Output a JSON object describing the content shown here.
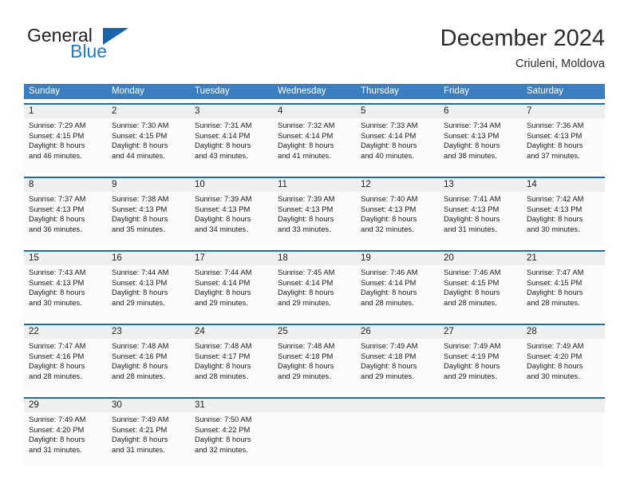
{
  "brand": {
    "name_part1": "General",
    "name_part2": "Blue",
    "logo_icon": "blue-triangle-icon"
  },
  "header": {
    "title": "December 2024",
    "location": "Criuleni, Moldova"
  },
  "colors": {
    "header_blue": "#3c7fc1",
    "week_divider_blue": "#1f6cb0",
    "day_number_band": "#efefef",
    "brand_blue": "#1e7bc4",
    "text": "#1a1a1a"
  },
  "weekdays": [
    "Sunday",
    "Monday",
    "Tuesday",
    "Wednesday",
    "Thursday",
    "Friday",
    "Saturday"
  ],
  "weeks": [
    {
      "days": [
        {
          "num": "1",
          "sunrise": "Sunrise: 7:29 AM",
          "sunset": "Sunset: 4:15 PM",
          "daylight_l1": "Daylight: 8 hours",
          "daylight_l2": "and 46 minutes."
        },
        {
          "num": "2",
          "sunrise": "Sunrise: 7:30 AM",
          "sunset": "Sunset: 4:15 PM",
          "daylight_l1": "Daylight: 8 hours",
          "daylight_l2": "and 44 minutes."
        },
        {
          "num": "3",
          "sunrise": "Sunrise: 7:31 AM",
          "sunset": "Sunset: 4:14 PM",
          "daylight_l1": "Daylight: 8 hours",
          "daylight_l2": "and 43 minutes."
        },
        {
          "num": "4",
          "sunrise": "Sunrise: 7:32 AM",
          "sunset": "Sunset: 4:14 PM",
          "daylight_l1": "Daylight: 8 hours",
          "daylight_l2": "and 41 minutes."
        },
        {
          "num": "5",
          "sunrise": "Sunrise: 7:33 AM",
          "sunset": "Sunset: 4:14 PM",
          "daylight_l1": "Daylight: 8 hours",
          "daylight_l2": "and 40 minutes."
        },
        {
          "num": "6",
          "sunrise": "Sunrise: 7:34 AM",
          "sunset": "Sunset: 4:13 PM",
          "daylight_l1": "Daylight: 8 hours",
          "daylight_l2": "and 38 minutes."
        },
        {
          "num": "7",
          "sunrise": "Sunrise: 7:36 AM",
          "sunset": "Sunset: 4:13 PM",
          "daylight_l1": "Daylight: 8 hours",
          "daylight_l2": "and 37 minutes."
        }
      ]
    },
    {
      "days": [
        {
          "num": "8",
          "sunrise": "Sunrise: 7:37 AM",
          "sunset": "Sunset: 4:13 PM",
          "daylight_l1": "Daylight: 8 hours",
          "daylight_l2": "and 36 minutes."
        },
        {
          "num": "9",
          "sunrise": "Sunrise: 7:38 AM",
          "sunset": "Sunset: 4:13 PM",
          "daylight_l1": "Daylight: 8 hours",
          "daylight_l2": "and 35 minutes."
        },
        {
          "num": "10",
          "sunrise": "Sunrise: 7:39 AM",
          "sunset": "Sunset: 4:13 PM",
          "daylight_l1": "Daylight: 8 hours",
          "daylight_l2": "and 34 minutes."
        },
        {
          "num": "11",
          "sunrise": "Sunrise: 7:39 AM",
          "sunset": "Sunset: 4:13 PM",
          "daylight_l1": "Daylight: 8 hours",
          "daylight_l2": "and 33 minutes."
        },
        {
          "num": "12",
          "sunrise": "Sunrise: 7:40 AM",
          "sunset": "Sunset: 4:13 PM",
          "daylight_l1": "Daylight: 8 hours",
          "daylight_l2": "and 32 minutes."
        },
        {
          "num": "13",
          "sunrise": "Sunrise: 7:41 AM",
          "sunset": "Sunset: 4:13 PM",
          "daylight_l1": "Daylight: 8 hours",
          "daylight_l2": "and 31 minutes."
        },
        {
          "num": "14",
          "sunrise": "Sunrise: 7:42 AM",
          "sunset": "Sunset: 4:13 PM",
          "daylight_l1": "Daylight: 8 hours",
          "daylight_l2": "and 30 minutes."
        }
      ]
    },
    {
      "days": [
        {
          "num": "15",
          "sunrise": "Sunrise: 7:43 AM",
          "sunset": "Sunset: 4:13 PM",
          "daylight_l1": "Daylight: 8 hours",
          "daylight_l2": "and 30 minutes."
        },
        {
          "num": "16",
          "sunrise": "Sunrise: 7:44 AM",
          "sunset": "Sunset: 4:13 PM",
          "daylight_l1": "Daylight: 8 hours",
          "daylight_l2": "and 29 minutes."
        },
        {
          "num": "17",
          "sunrise": "Sunrise: 7:44 AM",
          "sunset": "Sunset: 4:14 PM",
          "daylight_l1": "Daylight: 8 hours",
          "daylight_l2": "and 29 minutes."
        },
        {
          "num": "18",
          "sunrise": "Sunrise: 7:45 AM",
          "sunset": "Sunset: 4:14 PM",
          "daylight_l1": "Daylight: 8 hours",
          "daylight_l2": "and 29 minutes."
        },
        {
          "num": "19",
          "sunrise": "Sunrise: 7:46 AM",
          "sunset": "Sunset: 4:14 PM",
          "daylight_l1": "Daylight: 8 hours",
          "daylight_l2": "and 28 minutes."
        },
        {
          "num": "20",
          "sunrise": "Sunrise: 7:46 AM",
          "sunset": "Sunset: 4:15 PM",
          "daylight_l1": "Daylight: 8 hours",
          "daylight_l2": "and 28 minutes."
        },
        {
          "num": "21",
          "sunrise": "Sunrise: 7:47 AM",
          "sunset": "Sunset: 4:15 PM",
          "daylight_l1": "Daylight: 8 hours",
          "daylight_l2": "and 28 minutes."
        }
      ]
    },
    {
      "days": [
        {
          "num": "22",
          "sunrise": "Sunrise: 7:47 AM",
          "sunset": "Sunset: 4:16 PM",
          "daylight_l1": "Daylight: 8 hours",
          "daylight_l2": "and 28 minutes."
        },
        {
          "num": "23",
          "sunrise": "Sunrise: 7:48 AM",
          "sunset": "Sunset: 4:16 PM",
          "daylight_l1": "Daylight: 8 hours",
          "daylight_l2": "and 28 minutes."
        },
        {
          "num": "24",
          "sunrise": "Sunrise: 7:48 AM",
          "sunset": "Sunset: 4:17 PM",
          "daylight_l1": "Daylight: 8 hours",
          "daylight_l2": "and 28 minutes."
        },
        {
          "num": "25",
          "sunrise": "Sunrise: 7:48 AM",
          "sunset": "Sunset: 4:18 PM",
          "daylight_l1": "Daylight: 8 hours",
          "daylight_l2": "and 29 minutes."
        },
        {
          "num": "26",
          "sunrise": "Sunrise: 7:49 AM",
          "sunset": "Sunset: 4:18 PM",
          "daylight_l1": "Daylight: 8 hours",
          "daylight_l2": "and 29 minutes."
        },
        {
          "num": "27",
          "sunrise": "Sunrise: 7:49 AM",
          "sunset": "Sunset: 4:19 PM",
          "daylight_l1": "Daylight: 8 hours",
          "daylight_l2": "and 29 minutes."
        },
        {
          "num": "28",
          "sunrise": "Sunrise: 7:49 AM",
          "sunset": "Sunset: 4:20 PM",
          "daylight_l1": "Daylight: 8 hours",
          "daylight_l2": "and 30 minutes."
        }
      ]
    },
    {
      "days": [
        {
          "num": "29",
          "sunrise": "Sunrise: 7:49 AM",
          "sunset": "Sunset: 4:20 PM",
          "daylight_l1": "Daylight: 8 hours",
          "daylight_l2": "and 31 minutes."
        },
        {
          "num": "30",
          "sunrise": "Sunrise: 7:49 AM",
          "sunset": "Sunset: 4:21 PM",
          "daylight_l1": "Daylight: 8 hours",
          "daylight_l2": "and 31 minutes."
        },
        {
          "num": "31",
          "sunrise": "Sunrise: 7:50 AM",
          "sunset": "Sunset: 4:22 PM",
          "daylight_l1": "Daylight: 8 hours",
          "daylight_l2": "and 32 minutes."
        },
        {
          "num": "",
          "sunrise": "",
          "sunset": "",
          "daylight_l1": "",
          "daylight_l2": ""
        },
        {
          "num": "",
          "sunrise": "",
          "sunset": "",
          "daylight_l1": "",
          "daylight_l2": ""
        },
        {
          "num": "",
          "sunrise": "",
          "sunset": "",
          "daylight_l1": "",
          "daylight_l2": ""
        },
        {
          "num": "",
          "sunrise": "",
          "sunset": "",
          "daylight_l1": "",
          "daylight_l2": ""
        }
      ]
    }
  ]
}
